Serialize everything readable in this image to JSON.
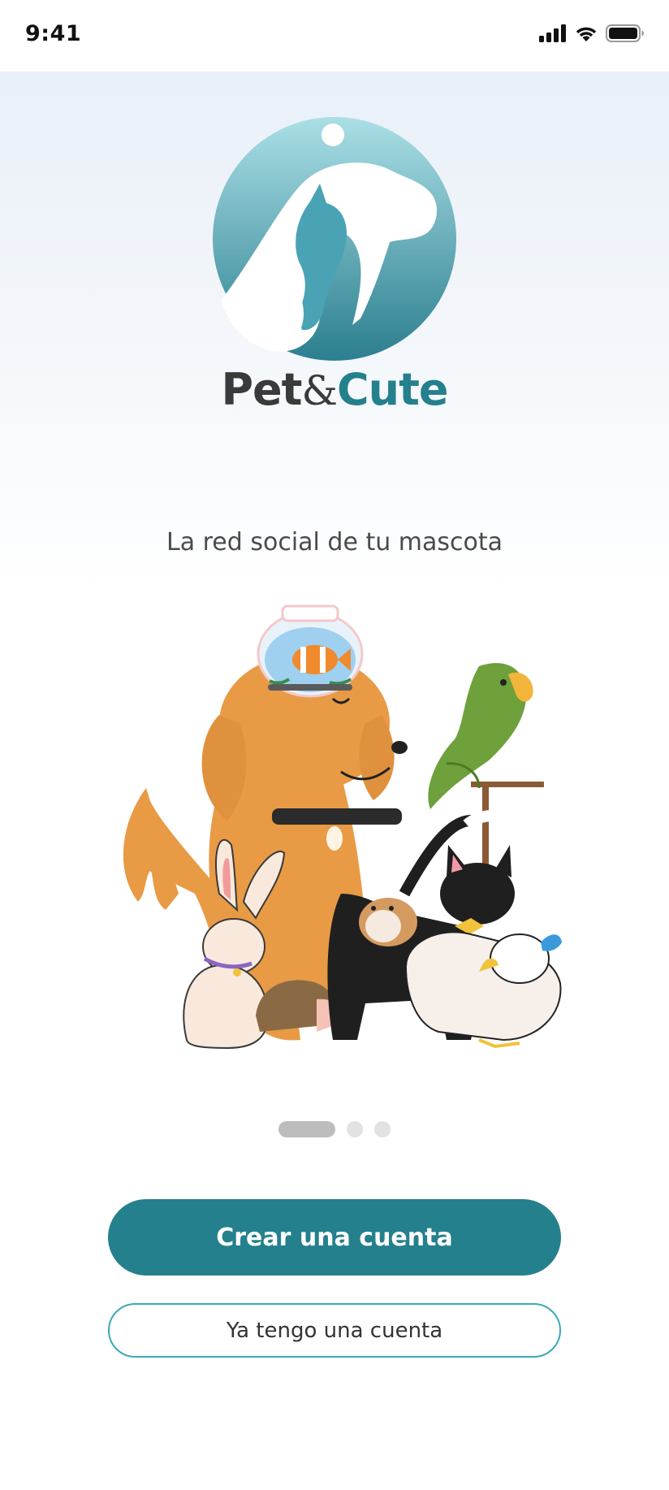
{
  "status_bar": {
    "time": "9:41",
    "icons": [
      "cellular-signal-icon",
      "wifi-icon",
      "battery-icon"
    ]
  },
  "logo": {
    "brand_part1": "Pet",
    "brand_part2": "&",
    "brand_part3": "Cute",
    "colors": {
      "dark": "#3a3a3a",
      "teal": "#24808c",
      "gradient_top": "#a9dde4",
      "gradient_bottom": "#2b7f8f"
    }
  },
  "tagline": "La red social de tu mascota",
  "illustration": {
    "animals": [
      "fishbowl-with-clownfish",
      "dog",
      "parrot-on-perch",
      "rabbit",
      "hedgehog",
      "hamster",
      "black-cat",
      "duck"
    ]
  },
  "pager": {
    "count": 3,
    "active_index": 0
  },
  "buttons": {
    "primary_label": "Crear una cuenta",
    "secondary_label": "Ya tengo una cuenta"
  },
  "colors": {
    "primary": "#24808c",
    "secondary_border": "#3aaab7"
  }
}
